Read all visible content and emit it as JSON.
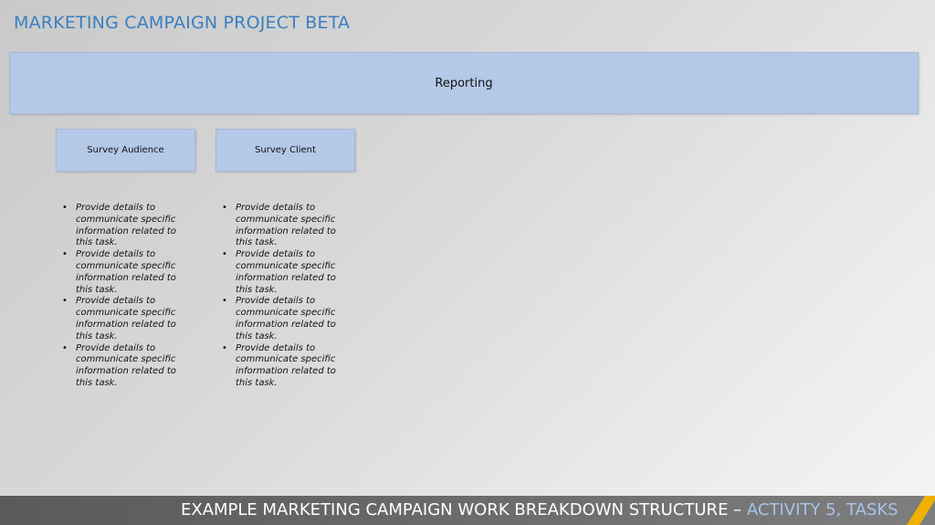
{
  "header": {
    "title": "MARKETING CAMPAIGN PROJECT BETA"
  },
  "wbs": {
    "parent": "Reporting",
    "tasks": [
      {
        "label": "Survey Audience",
        "bullets": [
          "Provide details to communicate specific information related to this task.",
          "Provide details to communicate specific information related to this task.",
          "Provide details to communicate specific information related to this task.",
          "Provide details to communicate specific information related to this task."
        ]
      },
      {
        "label": "Survey Client",
        "bullets": [
          "Provide details to communicate specific information related to this task.",
          "Provide details to communicate specific information related to this task.",
          "Provide details to communicate specific information related to this task.",
          "Provide details to communicate specific information related to this task."
        ]
      }
    ]
  },
  "footer": {
    "text": "EXAMPLE MARKETING CAMPAIGN WORK BREAKDOWN STRUCTURE – ",
    "accent": "ACTIVITY 5, TASKS"
  },
  "colors": {
    "title": "#3a7fc1",
    "box_fill": "#b4c8e8",
    "footer_accent": "#a9c4ea",
    "stripe": "#f0b000"
  }
}
